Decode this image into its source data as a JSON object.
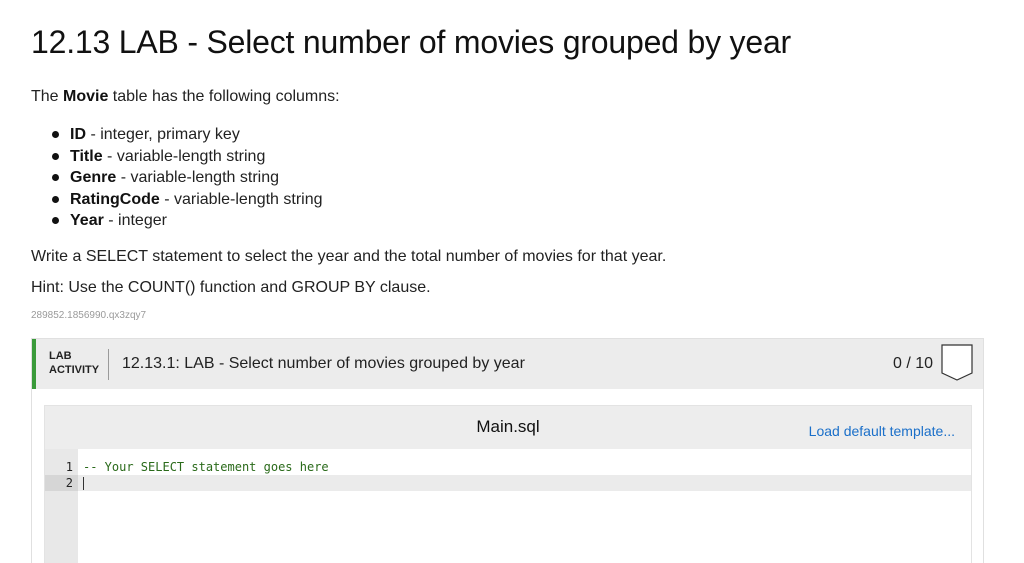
{
  "page": {
    "title": "12.13 LAB - Select number of movies grouped by year",
    "intro_prefix": "The ",
    "intro_table": "Movie",
    "intro_suffix": " table has the following columns:",
    "columns": [
      {
        "name": "ID",
        "desc": " - integer, primary key"
      },
      {
        "name": "Title",
        "desc": " - variable-length string"
      },
      {
        "name": "Genre",
        "desc": " - variable-length string"
      },
      {
        "name": "RatingCode",
        "desc": " - variable-length string"
      },
      {
        "name": "Year",
        "desc": " - integer"
      }
    ],
    "instruction": "Write a SELECT statement to select the year and the total number of movies for that year.",
    "hint": "Hint: Use the COUNT() function and GROUP BY clause.",
    "ref_id": "289852.1856990.qx3zqy7"
  },
  "lab": {
    "badge_line1": "LAB",
    "badge_line2": "ACTIVITY",
    "title": "12.13.1: LAB - Select number of movies grouped by year",
    "score": "0 / 10",
    "accent_color": "#3a9a3a",
    "bookmark_icon": "bookmark-icon"
  },
  "editor": {
    "file_name": "Main.sql",
    "load_template_label": "Load default template...",
    "lines": [
      {
        "num": "1",
        "text": "-- Your SELECT statement goes here"
      },
      {
        "num": "2",
        "text": ""
      }
    ]
  }
}
